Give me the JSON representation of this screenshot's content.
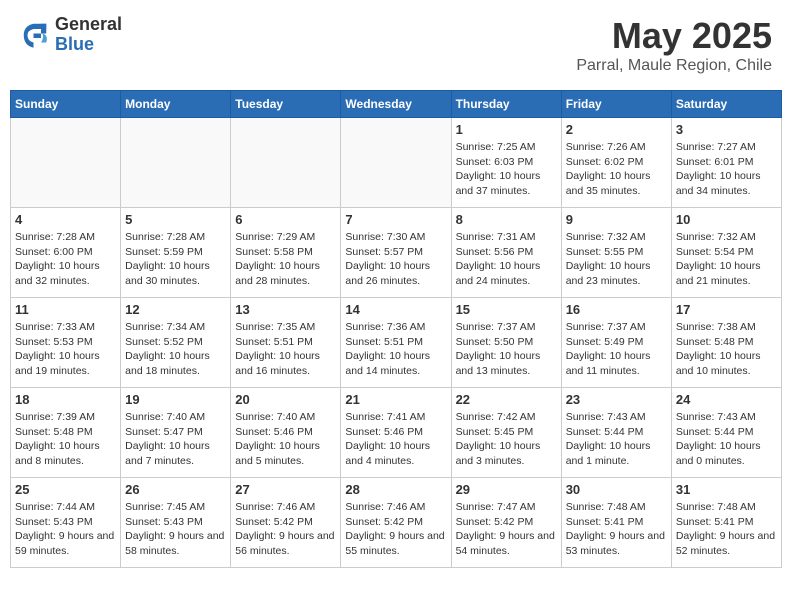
{
  "header": {
    "logo_general": "General",
    "logo_blue": "Blue",
    "month_title": "May 2025",
    "location": "Parral, Maule Region, Chile"
  },
  "weekdays": [
    "Sunday",
    "Monday",
    "Tuesday",
    "Wednesday",
    "Thursday",
    "Friday",
    "Saturday"
  ],
  "weeks": [
    [
      {
        "day": "",
        "info": ""
      },
      {
        "day": "",
        "info": ""
      },
      {
        "day": "",
        "info": ""
      },
      {
        "day": "",
        "info": ""
      },
      {
        "day": "1",
        "info": "Sunrise: 7:25 AM\nSunset: 6:03 PM\nDaylight: 10 hours and 37 minutes."
      },
      {
        "day": "2",
        "info": "Sunrise: 7:26 AM\nSunset: 6:02 PM\nDaylight: 10 hours and 35 minutes."
      },
      {
        "day": "3",
        "info": "Sunrise: 7:27 AM\nSunset: 6:01 PM\nDaylight: 10 hours and 34 minutes."
      }
    ],
    [
      {
        "day": "4",
        "info": "Sunrise: 7:28 AM\nSunset: 6:00 PM\nDaylight: 10 hours and 32 minutes."
      },
      {
        "day": "5",
        "info": "Sunrise: 7:28 AM\nSunset: 5:59 PM\nDaylight: 10 hours and 30 minutes."
      },
      {
        "day": "6",
        "info": "Sunrise: 7:29 AM\nSunset: 5:58 PM\nDaylight: 10 hours and 28 minutes."
      },
      {
        "day": "7",
        "info": "Sunrise: 7:30 AM\nSunset: 5:57 PM\nDaylight: 10 hours and 26 minutes."
      },
      {
        "day": "8",
        "info": "Sunrise: 7:31 AM\nSunset: 5:56 PM\nDaylight: 10 hours and 24 minutes."
      },
      {
        "day": "9",
        "info": "Sunrise: 7:32 AM\nSunset: 5:55 PM\nDaylight: 10 hours and 23 minutes."
      },
      {
        "day": "10",
        "info": "Sunrise: 7:32 AM\nSunset: 5:54 PM\nDaylight: 10 hours and 21 minutes."
      }
    ],
    [
      {
        "day": "11",
        "info": "Sunrise: 7:33 AM\nSunset: 5:53 PM\nDaylight: 10 hours and 19 minutes."
      },
      {
        "day": "12",
        "info": "Sunrise: 7:34 AM\nSunset: 5:52 PM\nDaylight: 10 hours and 18 minutes."
      },
      {
        "day": "13",
        "info": "Sunrise: 7:35 AM\nSunset: 5:51 PM\nDaylight: 10 hours and 16 minutes."
      },
      {
        "day": "14",
        "info": "Sunrise: 7:36 AM\nSunset: 5:51 PM\nDaylight: 10 hours and 14 minutes."
      },
      {
        "day": "15",
        "info": "Sunrise: 7:37 AM\nSunset: 5:50 PM\nDaylight: 10 hours and 13 minutes."
      },
      {
        "day": "16",
        "info": "Sunrise: 7:37 AM\nSunset: 5:49 PM\nDaylight: 10 hours and 11 minutes."
      },
      {
        "day": "17",
        "info": "Sunrise: 7:38 AM\nSunset: 5:48 PM\nDaylight: 10 hours and 10 minutes."
      }
    ],
    [
      {
        "day": "18",
        "info": "Sunrise: 7:39 AM\nSunset: 5:48 PM\nDaylight: 10 hours and 8 minutes."
      },
      {
        "day": "19",
        "info": "Sunrise: 7:40 AM\nSunset: 5:47 PM\nDaylight: 10 hours and 7 minutes."
      },
      {
        "day": "20",
        "info": "Sunrise: 7:40 AM\nSunset: 5:46 PM\nDaylight: 10 hours and 5 minutes."
      },
      {
        "day": "21",
        "info": "Sunrise: 7:41 AM\nSunset: 5:46 PM\nDaylight: 10 hours and 4 minutes."
      },
      {
        "day": "22",
        "info": "Sunrise: 7:42 AM\nSunset: 5:45 PM\nDaylight: 10 hours and 3 minutes."
      },
      {
        "day": "23",
        "info": "Sunrise: 7:43 AM\nSunset: 5:44 PM\nDaylight: 10 hours and 1 minute."
      },
      {
        "day": "24",
        "info": "Sunrise: 7:43 AM\nSunset: 5:44 PM\nDaylight: 10 hours and 0 minutes."
      }
    ],
    [
      {
        "day": "25",
        "info": "Sunrise: 7:44 AM\nSunset: 5:43 PM\nDaylight: 9 hours and 59 minutes."
      },
      {
        "day": "26",
        "info": "Sunrise: 7:45 AM\nSunset: 5:43 PM\nDaylight: 9 hours and 58 minutes."
      },
      {
        "day": "27",
        "info": "Sunrise: 7:46 AM\nSunset: 5:42 PM\nDaylight: 9 hours and 56 minutes."
      },
      {
        "day": "28",
        "info": "Sunrise: 7:46 AM\nSunset: 5:42 PM\nDaylight: 9 hours and 55 minutes."
      },
      {
        "day": "29",
        "info": "Sunrise: 7:47 AM\nSunset: 5:42 PM\nDaylight: 9 hours and 54 minutes."
      },
      {
        "day": "30",
        "info": "Sunrise: 7:48 AM\nSunset: 5:41 PM\nDaylight: 9 hours and 53 minutes."
      },
      {
        "day": "31",
        "info": "Sunrise: 7:48 AM\nSunset: 5:41 PM\nDaylight: 9 hours and 52 minutes."
      }
    ]
  ]
}
